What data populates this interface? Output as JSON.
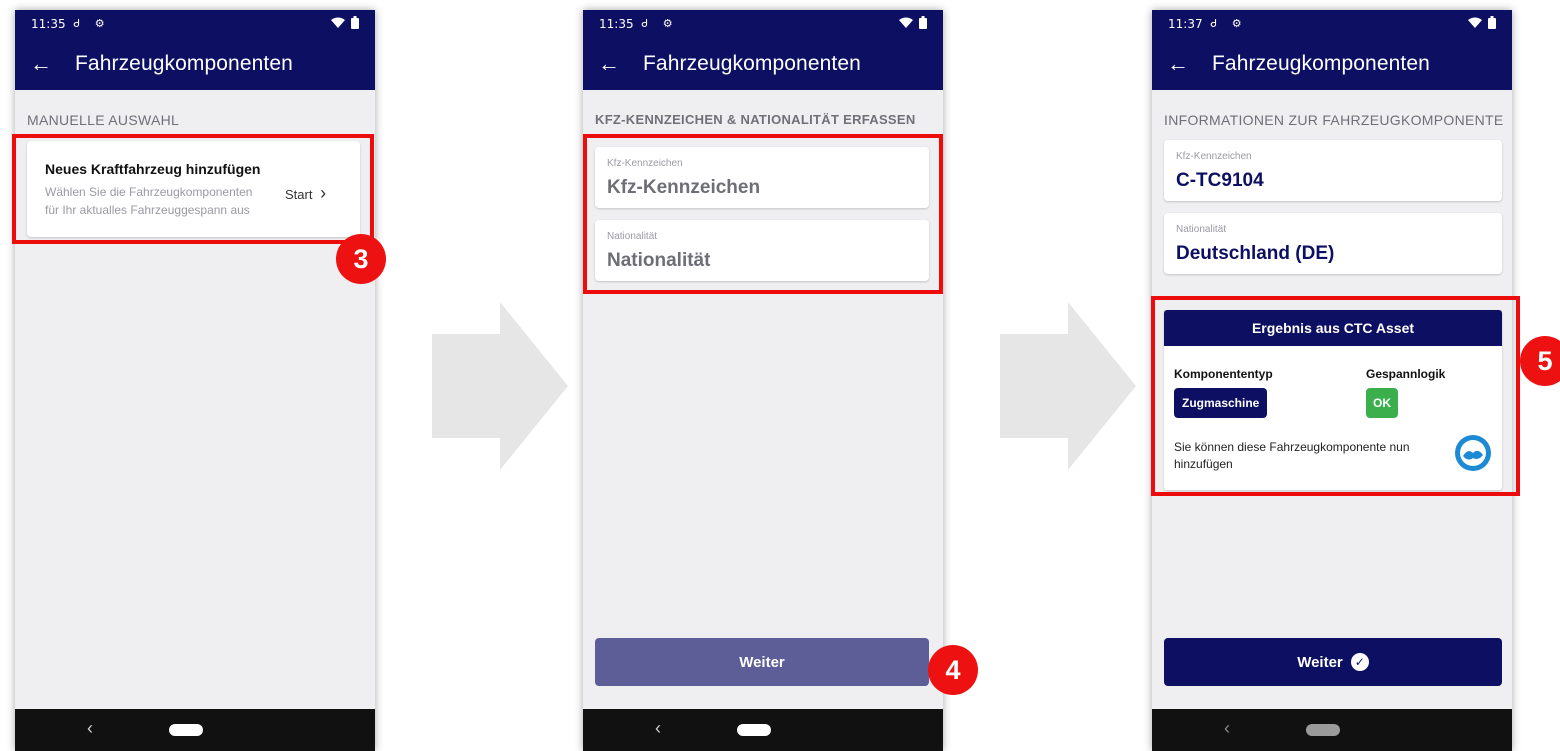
{
  "screens": [
    {
      "status_time": "11:35",
      "status_icons": "Ꮷ ⚙",
      "app_title": "Fahrzeugkomponenten",
      "section_title": "MANUELLE AUSWAHL",
      "card_title": "Neues Kraftfahrzeug hinzufügen",
      "card_desc_line1": "Wählen Sie die Fahrzeugkomponenten",
      "card_desc_line2": "für Ihr aktualles Fahrzeuggespann aus",
      "card_action": "Start",
      "badge": "3"
    },
    {
      "status_time": "11:35",
      "status_icons": "Ꮷ ⚙",
      "app_title": "Fahrzeugkomponenten",
      "section_title": "KFZ-KENNZEICHEN & NATIONALITÄT ERFASSEN",
      "plate_label": "Kfz-Kennzeichen",
      "plate_placeholder": "Kfz-Kennzeichen",
      "nation_label": "Nationalität",
      "nation_placeholder": "Nationalität",
      "button_label": "Weiter",
      "badge": "4"
    },
    {
      "status_time": "11:37",
      "status_icons": "Ꮷ ⚙",
      "app_title": "Fahrzeugkomponenten",
      "section_title": "INFORMATIONEN ZUR FAHRZEUGKOMPONENTE",
      "plate_label": "Kfz-Kennzeichen",
      "plate_value": "C-TC9104",
      "nation_label": "Nationalität",
      "nation_value": "Deutschland (DE)",
      "result_header": "Ergebnis aus CTC Asset",
      "component_type_label": "Komponententyp",
      "component_type_value": "Zugmaschine",
      "gespann_label": "Gespannlogik",
      "gespann_value": "OK",
      "result_message_line1": "Sie können diese Fahrzeugkomponente nun",
      "result_message_line2": "hinzufügen",
      "button_label": "Weiter",
      "badge": "5"
    }
  ],
  "icons": {
    "back": "←",
    "chevron": "›",
    "nav_back": "‹",
    "wifi": "▼",
    "battery": "▮",
    "check": "✓"
  },
  "colors": {
    "primary": "#0d0f63",
    "button_disabled": "#5d5d98",
    "highlight_red": "#ee0b0b",
    "ok_green": "#3aaf4c",
    "arrow_grey": "#e6e6e6"
  }
}
